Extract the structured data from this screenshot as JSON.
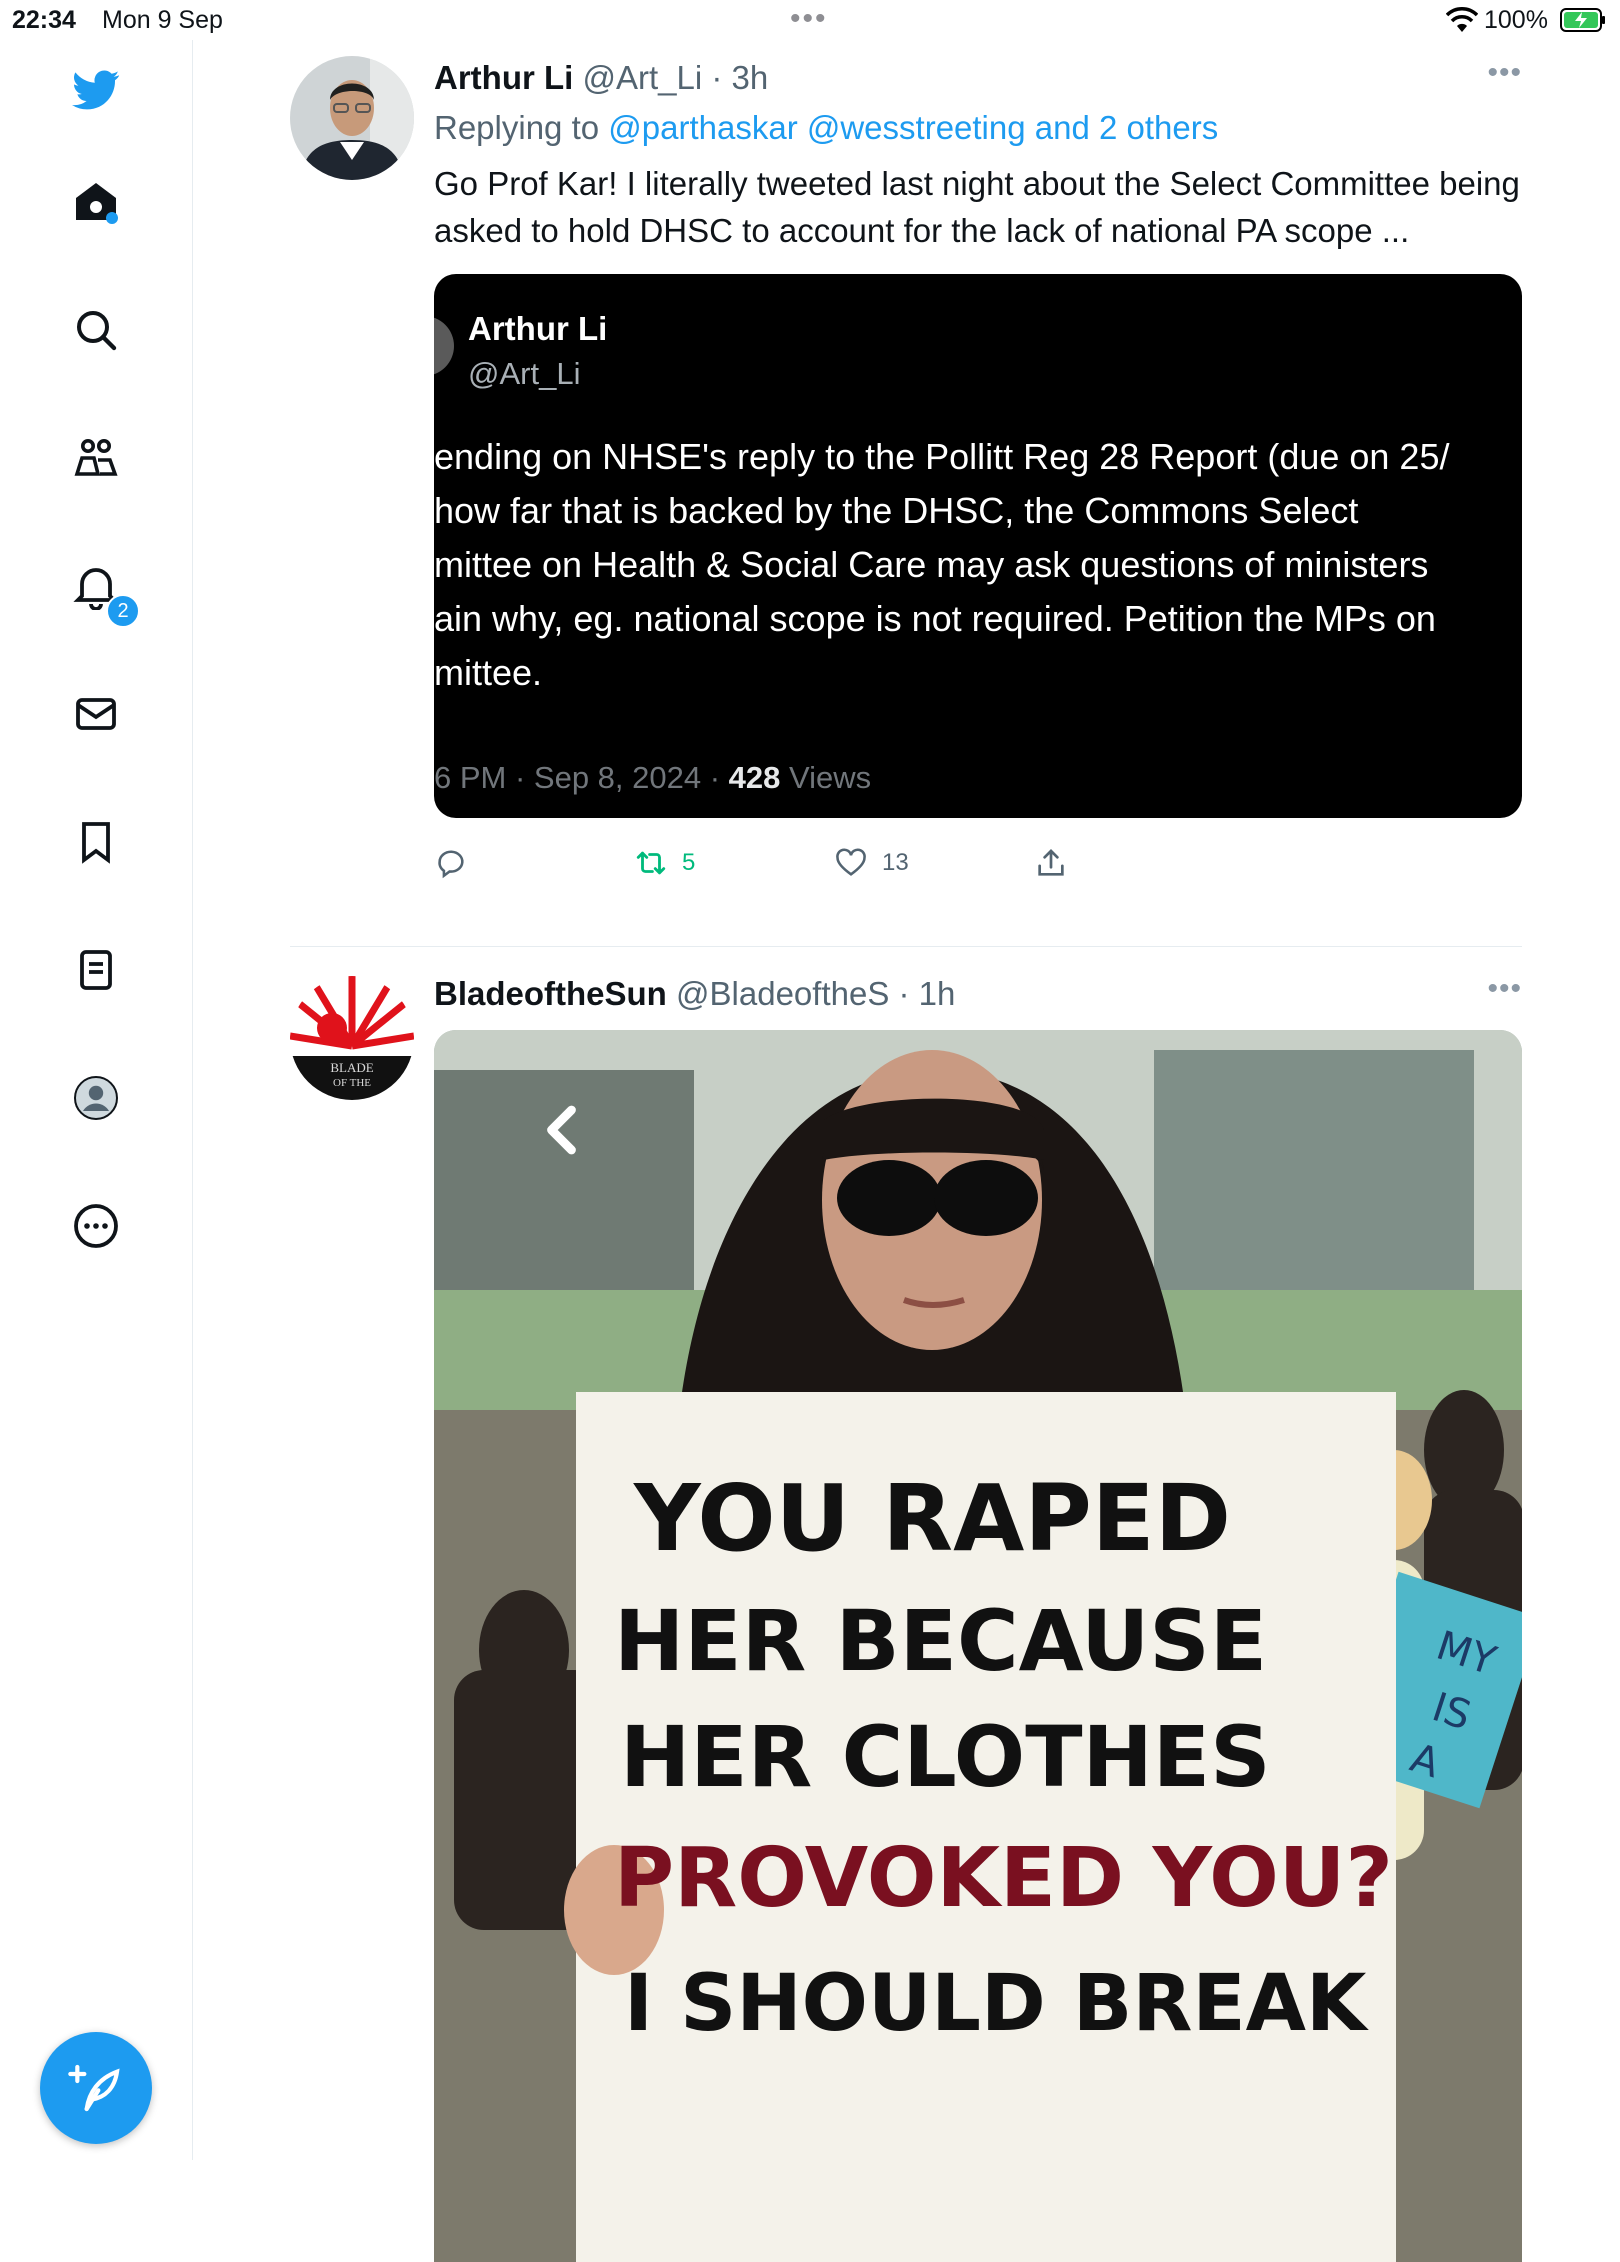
{
  "status": {
    "time": "22:34",
    "date": "Mon 9 Sep",
    "battery": "100%"
  },
  "sidebar": {
    "notifications_badge": "2",
    "items": [
      "home-icon",
      "search-icon",
      "communities-icon",
      "notifications-icon",
      "messages-icon",
      "bookmarks-icon",
      "lists-icon",
      "profile-icon",
      "more-icon"
    ]
  },
  "tweets": [
    {
      "name": "Arthur Li",
      "handle": "@Art_Li",
      "time": "· 3h",
      "replying_prefix": "Replying to ",
      "replying_to": "@parthaskar @wesstreeting and 2 others",
      "text": "Go Prof Kar! I literally tweeted last night about the Select Committee being asked to hold DHSC to account for the lack of national PA scope ...",
      "quote": {
        "name": "Arthur Li",
        "handle": "@Art_Li",
        "lines": [
          "ending on NHSE's reply to the Pollitt Reg 28 Report (due on 25/",
          "how far that is backed by the DHSC, the Commons Select",
          "mittee on Health & Social Care may ask questions of ministers",
          "ain why, eg. national scope is not required. Petition the MPs on",
          "mittee."
        ],
        "meta_prefix": "6 PM · Sep 8, 2024 · ",
        "views_count": "428",
        "views_label": " Views"
      },
      "actions": {
        "replies": "",
        "retweets": "5",
        "likes": "13"
      }
    },
    {
      "name": "BladeoftheSun",
      "handle": "@BladeoftheS",
      "time": "· 1h",
      "image": {
        "sign_lines": [
          "YOU RAPED",
          "HER BECAUSE",
          "HER CLOTHES",
          "PROVOKED YOU?",
          "I SHOULD BREAK"
        ],
        "protest_sign": [
          "MY",
          "IS",
          "A"
        ]
      }
    }
  ],
  "colors": {
    "accent": "#1d9bf0",
    "retweet": "#00ba7c",
    "text": "#0f1419",
    "muted": "#536471"
  }
}
